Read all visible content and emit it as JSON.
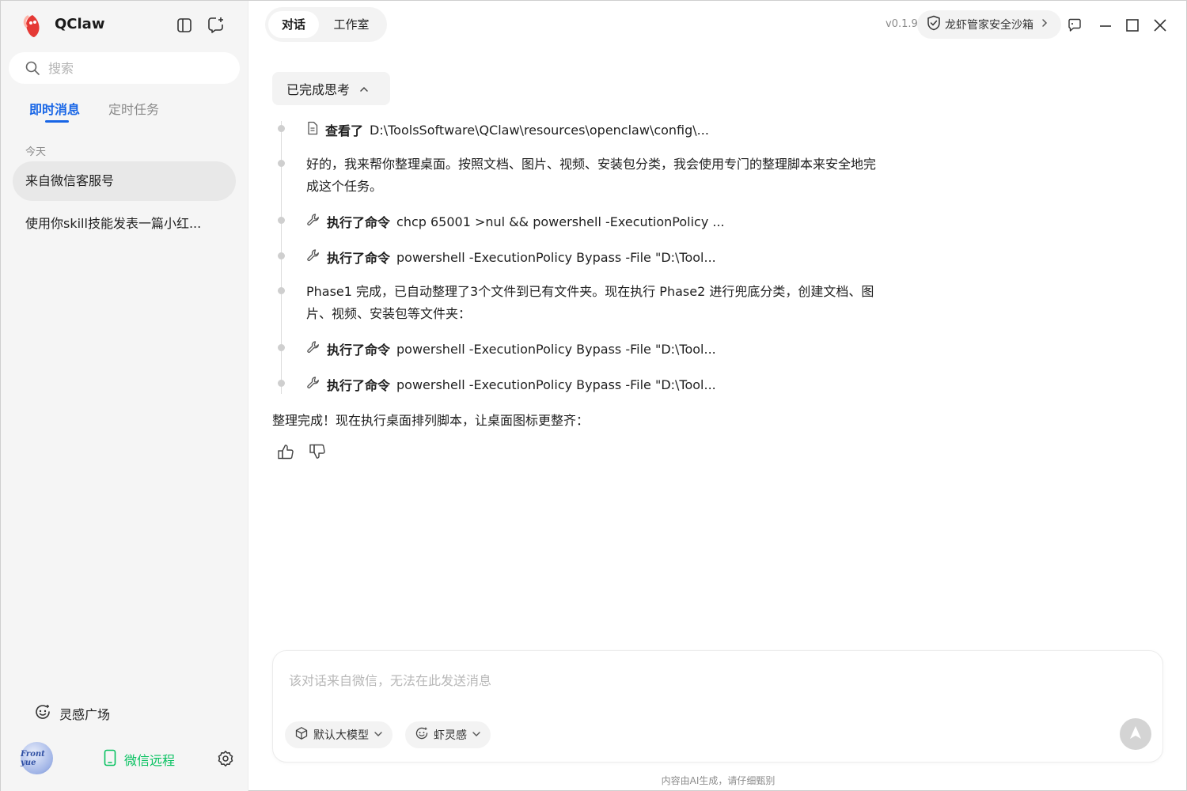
{
  "app": {
    "title": "QClaw",
    "version": "v0.1.9"
  },
  "sidebar": {
    "search_placeholder": "搜索",
    "tabs": [
      {
        "label": "即时消息",
        "active": true
      },
      {
        "label": "定时任务",
        "active": false
      }
    ],
    "section_today": "今天",
    "chats": [
      {
        "title": "来自微信客服号",
        "selected": true
      },
      {
        "title": "使用你skill技能发表一篇小红...",
        "selected": false
      }
    ],
    "inspiration_label": "灵感广场",
    "wechat_remote_label": "微信远程",
    "avatar_text": "Front yue"
  },
  "topbar": {
    "mode_tabs": [
      {
        "label": "对话",
        "active": true
      },
      {
        "label": "工作室",
        "active": false
      }
    ],
    "sandbox_label": "龙虾管家安全沙箱"
  },
  "thinking": {
    "toggle_label": "已完成思考",
    "steps": [
      {
        "type": "file",
        "action": "查看了",
        "detail": "D:\\ToolsSoftware\\QClaw\\resources\\openclaw\\config\\..."
      },
      {
        "type": "text",
        "text": "好的，我来帮你整理桌面。按照文档、图片、视频、安装包分类，我会使用专门的整理脚本来安全地完成这个任务。"
      },
      {
        "type": "command",
        "action": "执行了命令",
        "detail": "chcp 65001 >nul && powershell -ExecutionPolicy ..."
      },
      {
        "type": "command",
        "action": "执行了命令",
        "detail": "powershell -ExecutionPolicy Bypass -File \"D:\\Tool..."
      },
      {
        "type": "text",
        "text": "Phase1 完成，已自动整理了3个文件到已有文件夹。现在执行 Phase2 进行兜底分类，创建文档、图片、视频、安装包等文件夹："
      },
      {
        "type": "command",
        "action": "执行了命令",
        "detail": "powershell -ExecutionPolicy Bypass -File \"D:\\Tool..."
      },
      {
        "type": "command",
        "action": "执行了命令",
        "detail": "powershell -ExecutionPolicy Bypass -File \"D:\\Tool..."
      }
    ]
  },
  "message": {
    "final_text": "整理完成！现在执行桌面排列脚本，让桌面图标更整齐："
  },
  "composer": {
    "placeholder": "该对话来自微信，无法在此发送消息",
    "model_label": "默认大模型",
    "inspiration_label": "虾灵感"
  },
  "footer": {
    "disclaimer": "内容由AI生成，请仔细甄别"
  },
  "colors": {
    "accent": "#1765e6",
    "wechat_green": "#07c160",
    "logo_red": "#e53935"
  }
}
